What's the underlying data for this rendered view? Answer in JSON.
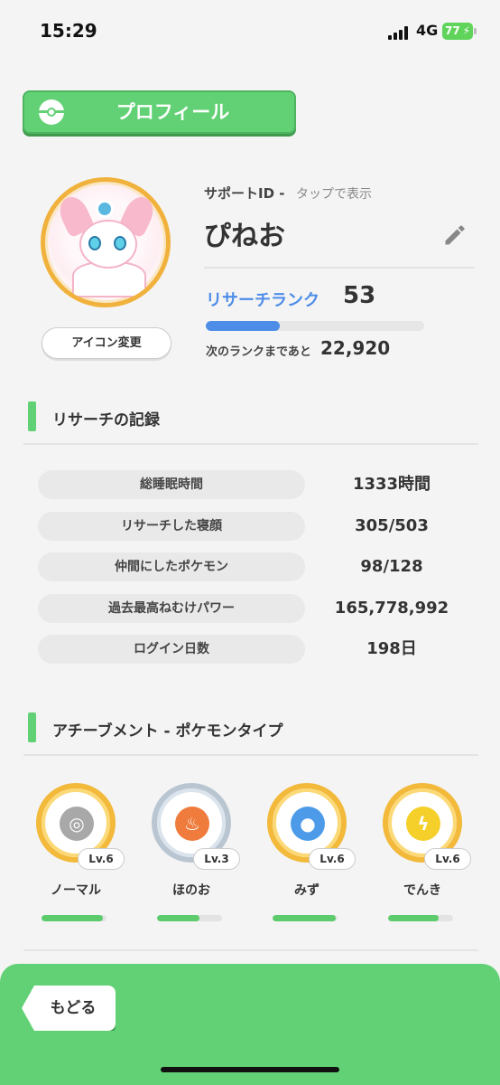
{
  "status_bar": {
    "time": "15:29",
    "network": "4G",
    "battery": "77"
  },
  "header": {
    "title": "プロフィール"
  },
  "profile": {
    "support_id_label": "サポートID -",
    "support_id_tap": "タップで表示",
    "name": "ぴねお",
    "icon_change_label": "アイコン変更",
    "rank_label": "リサーチランク",
    "rank_value": "53",
    "rank_progress": 0.34,
    "next_rank_label": "次のランクまであと",
    "next_rank_value": "22,920"
  },
  "records": {
    "title": "リサーチの記録",
    "rows": [
      {
        "label": "総睡眠時間",
        "value": "1333時間"
      },
      {
        "label": "リサーチした寝顔",
        "value": "305/503"
      },
      {
        "label": "仲間にしたポケモン",
        "value": "98/128"
      },
      {
        "label": "過去最高ねむけパワー",
        "value": "165,778,992"
      },
      {
        "label": "ログイン日数",
        "value": "198日"
      }
    ]
  },
  "achievements": {
    "title": "アチーブメント - ポケモンタイプ",
    "medals": [
      {
        "name": "ノーマル",
        "level": "Lv.6",
        "icon": "normal-type-icon",
        "color": "#a8a8a8",
        "progress": 0.95
      },
      {
        "name": "ほのお",
        "level": "Lv.3",
        "icon": "fire-type-icon",
        "color": "#ef7b3c",
        "progress": 0.65
      },
      {
        "name": "みず",
        "level": "Lv.6",
        "icon": "water-type-icon",
        "color": "#4d9be8",
        "progress": 0.97
      },
      {
        "name": "でんき",
        "level": "Lv.6",
        "icon": "electric-type-icon",
        "color": "#f5cf2a",
        "progress": 0.78
      }
    ]
  },
  "footer": {
    "back_label": "もどる"
  },
  "colors": {
    "accent_green": "#62d175",
    "rank_blue": "#4d8de8",
    "medal_gold": "#f2b93b"
  }
}
